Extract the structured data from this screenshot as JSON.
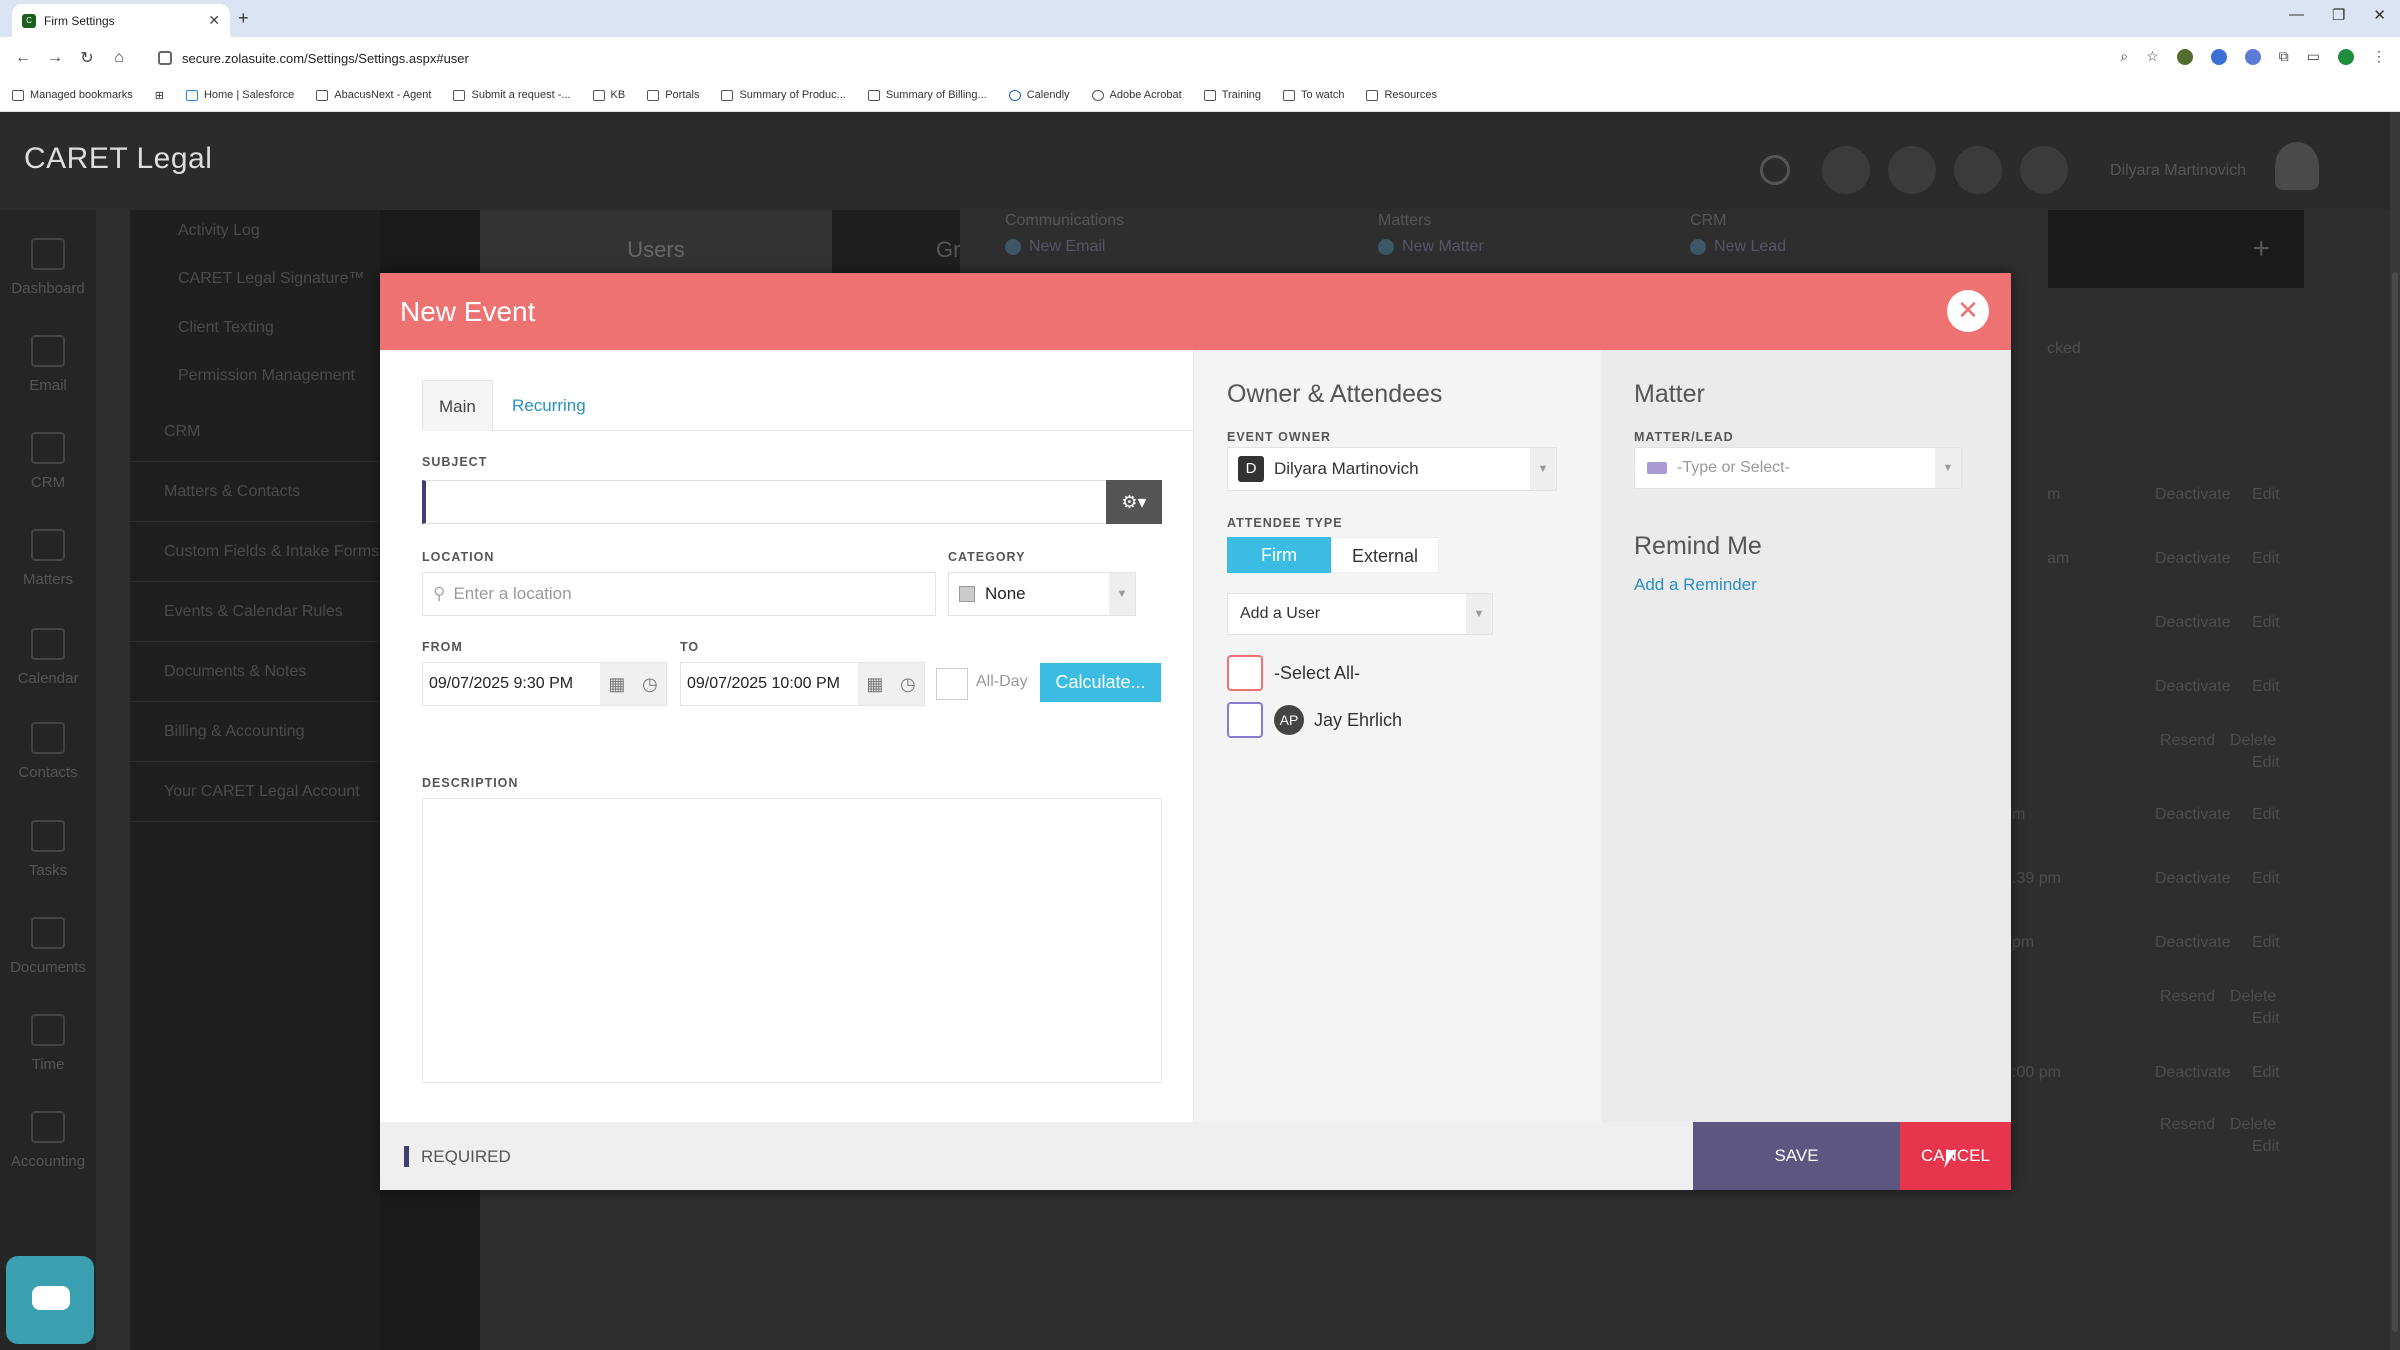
{
  "browser": {
    "tab_title": "Firm Settings",
    "url": "secure.zolasuite.com/Settings/Settings.aspx#user",
    "bookmarks": [
      "Managed bookmarks",
      "Home | Salesforce",
      "AbacusNext - Agent",
      "Submit a request -...",
      "KB",
      "Portals",
      "Summary of Produc...",
      "Summary of Billing...",
      "Calendly",
      "Adobe Acrobat",
      "Training",
      "To watch",
      "Resources"
    ]
  },
  "app": {
    "logo": "CARET Legal",
    "user_name": "Dilyara Martinovich"
  },
  "left_nav": [
    "Dashboard",
    "Email",
    "CRM",
    "Matters",
    "Calendar",
    "Contacts",
    "Tasks",
    "Documents",
    "Time",
    "Accounting"
  ],
  "settings_nav": {
    "sub_items": [
      "Activity Log",
      "CARET Legal Signature™",
      "Client Texting",
      "Permission Management"
    ],
    "items": [
      "CRM",
      "Matters & Contacts",
      "Custom Fields & Intake Forms",
      "Events & Calendar Rules",
      "Documents & Notes",
      "Billing & Accounting",
      "Your CARET Legal Account"
    ]
  },
  "background": {
    "users_tab": "Users",
    "g_tab": "Gr",
    "sections": [
      {
        "title": "Communications",
        "item": "New Email"
      },
      {
        "title": "Matters",
        "item": "New Matter"
      },
      {
        "title": "CRM",
        "item": "New Lead"
      }
    ],
    "locked": "cked",
    "actions": [
      "Deactivate",
      "Edit",
      "Resend",
      "Delete"
    ],
    "times": [
      "m",
      "am",
      ".39 pm",
      "pm",
      ":00 pm",
      "m",
      "m"
    ]
  },
  "modal": {
    "title": "New Event",
    "tabs": {
      "main": "Main",
      "recurring": "Recurring"
    },
    "subject_label": "SUBJECT",
    "location_label": "LOCATION",
    "location_placeholder": "Enter a location",
    "category_label": "CATEGORY",
    "category_value": "None",
    "from_label": "FROM",
    "from_value": "09/07/2025 9:30 PM",
    "to_label": "TO",
    "to_value": "09/07/2025 10:00 PM",
    "all_day": "All-Day",
    "calculate": "Calculate...",
    "description_label": "DESCRIPTION",
    "owner_heading": "Owner & Attendees",
    "event_owner_label": "EVENT OWNER",
    "owner_initial": "D",
    "owner_name": "Dilyara Martinovich",
    "attendee_type_label": "ATTENDEE TYPE",
    "firm": "Firm",
    "external": "External",
    "add_user": "Add a User",
    "select_all": "-Select All-",
    "attendee_initials": "AP",
    "attendee_name": "Jay Ehrlich",
    "matter_heading": "Matter",
    "matter_label": "MATTER/LEAD",
    "matter_placeholder": "-Type or Select-",
    "remind_heading": "Remind Me",
    "add_reminder": "Add a Reminder",
    "required": "REQUIRED",
    "save": "SAVE",
    "cancel": "CANCEL"
  }
}
